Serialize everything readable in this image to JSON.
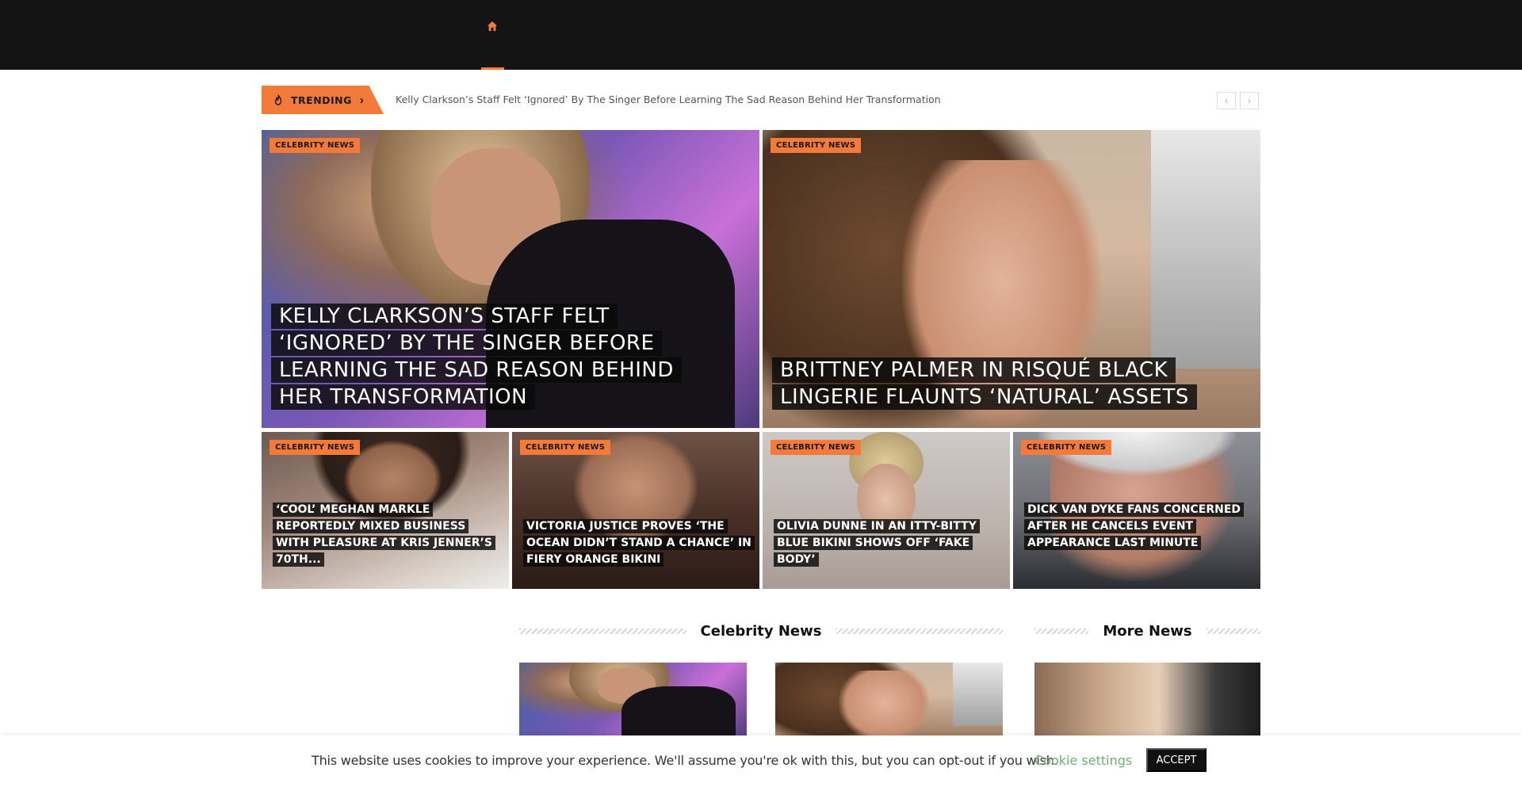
{
  "nav": {
    "home_icon": "home-icon",
    "accent_color": "#f47a3a"
  },
  "trending": {
    "label": "TRENDING",
    "icon": "fire-icon",
    "headline": "Kelly Clarkson’s Staff Felt ‘Ignored’ By The Singer Before Learning The Sad Reason Behind Her Transformation",
    "prev_symbol": "‹",
    "next_symbol": "›"
  },
  "featured": [
    {
      "category": "CELEBRITY NEWS",
      "title": "KELLY CLARKSON’S STAFF FELT ‘IGNORED’ BY THE SINGER BEFORE LEARNING THE SAD REASON BEHIND HER TRANSFORMATION"
    },
    {
      "category": "CELEBRITY NEWS",
      "title": "BRITTNEY PALMER IN RISQUÉ BLACK LINGERIE FLAUNTS ‘NATURAL’ ASSETS"
    }
  ],
  "grid": [
    {
      "category": "CELEBRITY NEWS",
      "title": "‘COOL’ MEGHAN MARKLE REPORTEDLY MIXED BUSINESS WITH PLEASURE AT KRIS JENNER’S 70TH..."
    },
    {
      "category": "CELEBRITY NEWS",
      "title": "VICTORIA JUSTICE PROVES ‘THE OCEAN DIDN’T STAND A CHANCE’ IN FIERY ORANGE BIKINI"
    },
    {
      "category": "CELEBRITY NEWS",
      "title": "OLIVIA DUNNE IN AN ITTY-BITTY BLUE BIKINI SHOWS OFF ‘FAKE BODY’"
    },
    {
      "category": "CELEBRITY NEWS",
      "title": "DICK VAN DYKE FANS CONCERNED AFTER HE CANCELS EVENT APPEARANCE LAST MINUTE"
    }
  ],
  "sections": {
    "celebrity_news": "Celebrity News",
    "more_news": "More News"
  },
  "cookie": {
    "message": "This website uses cookies to improve your experience. We'll assume you're ok with this, but you can opt-out if you wish.",
    "settings_label": "Cookie settings",
    "accept_label": "ACCEPT",
    "settings_color": "#6bb36b"
  }
}
